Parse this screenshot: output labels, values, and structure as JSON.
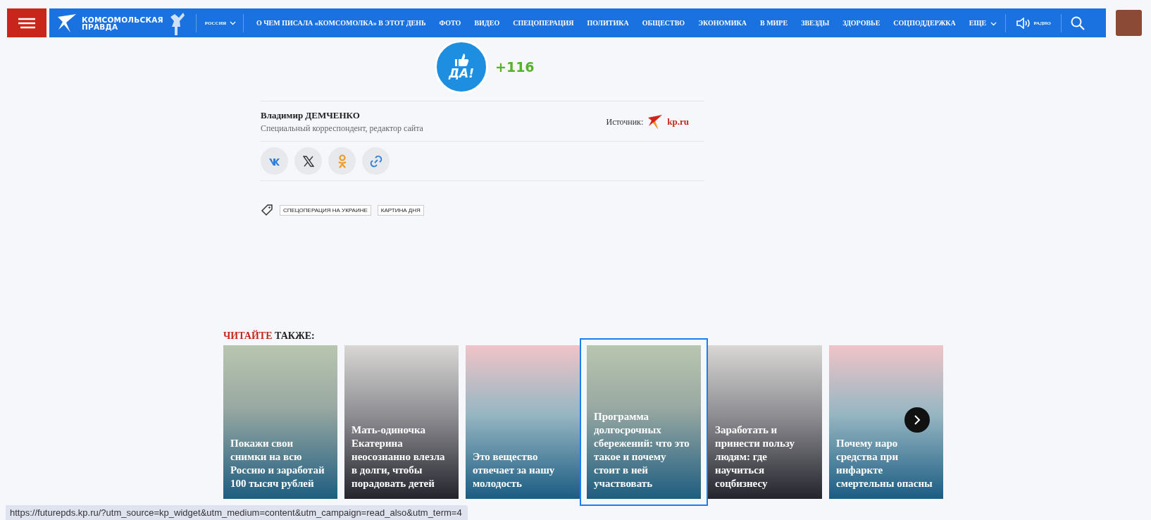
{
  "header": {
    "logo_lines": [
      "КОМСОМОЛЬСКАЯ",
      "ПРАВДА"
    ],
    "region": "РОССИЯ",
    "nav": [
      "О ЧЕМ ПИСАЛА «КОМСОМОЛКА» В ЭТОТ ДЕНЬ",
      "ФОТО",
      "ВИДЕО",
      "СПЕЦОПЕРАЦИЯ",
      "ПОЛИТИКА",
      "ОБЩЕСТВО",
      "ЭКОНОМИКА",
      "В МИРЕ",
      "ЗВЕЗДЫ",
      "ЗДОРОВЬЕ",
      "СОЦПОДДЕРЖКА"
    ],
    "more": "ЕЩЕ",
    "radio": "РАДИО"
  },
  "article": {
    "likes": {
      "label": "ДА!",
      "count": "+116"
    },
    "author": {
      "name": "Владимир ДЕМЧЕНКО",
      "role": "Специальный корреспондент, редактор сайта"
    },
    "source": {
      "label": "Источник:",
      "site": "kp.ru"
    },
    "share": [
      {
        "kind": "vk"
      },
      {
        "kind": "x"
      },
      {
        "kind": "ok"
      },
      {
        "kind": "link"
      }
    ],
    "tags": [
      "СПЕЦОПЕРАЦИЯ НА УКРАИНЕ",
      "КАРТИНА ДНЯ"
    ]
  },
  "read_also": {
    "title_accent": "ЧИТАЙТЕ",
    "title_rest": "ТАКЖЕ:",
    "cards": [
      {
        "title": "Покажи свои снимки на всю Россию и заработай 100 тысяч рублей",
        "hovered": false
      },
      {
        "title": "Мать-одиночка Екатерина неосознанно влезла в долги, чтобы порадовать детей",
        "hovered": false
      },
      {
        "title": "Это вещество отвечает за нашу молодость",
        "hovered": false
      },
      {
        "title": "Программа долгосрочных сбережений: что это такое и почему стоит в ней участвовать",
        "hovered": true
      },
      {
        "title": "Заработать и принести пользу людям: где научиться соцбизнесу",
        "hovered": false
      },
      {
        "title": "Почему наро средства при инфаркте смертельны опасны",
        "hovered": false
      }
    ]
  },
  "status_bar": {
    "url": "https://futurepds.kp.ru/?utm_source=kp_widget&utm_medium=content&utm_campaign=read_also&utm_term=4"
  }
}
